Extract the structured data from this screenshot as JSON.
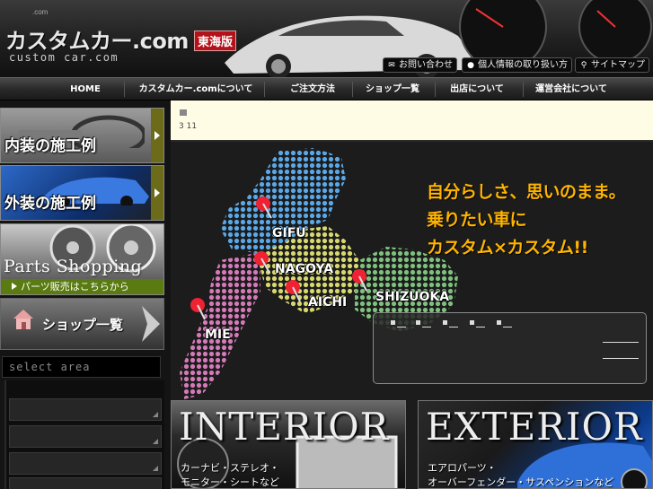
{
  "header": {
    "logo_small": ".com",
    "logo_main": "カスタムカー.com",
    "logo_sub": "custom car.com",
    "region_badge": "東海版",
    "links": [
      {
        "label": "お問い合わせ",
        "icon": "mail-icon"
      },
      {
        "label": "個人情報の取り扱い方",
        "icon": "person-icon"
      },
      {
        "label": "サイトマップ",
        "icon": "magnifier-icon"
      }
    ]
  },
  "nav": {
    "items": [
      "HOME",
      "カスタムカー.comについて",
      "ご注文方法",
      "ショップ一覧",
      "出店について",
      "運営会社について"
    ]
  },
  "sidebar": {
    "interior_label": "内装の施工例",
    "exterior_label": "外装の施工例",
    "parts_title": "Parts Shopping",
    "parts_strip": "パーツ販売はこちらから",
    "shop_label": "ショップ一覧",
    "select_area": "select area"
  },
  "news": {
    "date": "3 11"
  },
  "map": {
    "taglines": [
      "自分らしさ、思いのまま。",
      "乗りたい車に",
      "カスタム×カスタム!!"
    ],
    "cities": [
      "GIFU",
      "NAGOYA",
      "AICHI",
      "SHIZUOKA",
      "MIE"
    ],
    "region_colors": {
      "gifu": "#5aa8e8",
      "aichi": "#d8d870",
      "shizuoka": "#7ec07e",
      "mie": "#d47ab8"
    },
    "accent": "#ffb400"
  },
  "banners": {
    "interior_title": "INTERIOR",
    "interior_desc_1": "カーナビ・ステレオ・",
    "interior_desc_2": "モニター・シートなど",
    "exterior_title": "EXTERIOR",
    "exterior_desc_1": "エアロパーツ・",
    "exterior_desc_2": "オーバーフェンダー・サスペンションなど"
  }
}
